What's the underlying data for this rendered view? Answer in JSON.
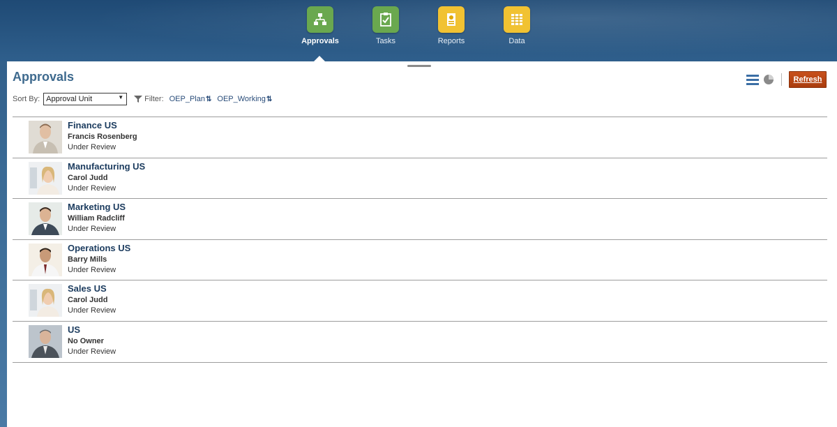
{
  "nav": {
    "items": [
      {
        "label": "Approvals",
        "icon": "approvals-hierarchy-icon",
        "color": "#6aa84f",
        "active": true
      },
      {
        "label": "Tasks",
        "icon": "tasks-clipboard-check-icon",
        "color": "#6aa84f",
        "active": false
      },
      {
        "label": "Reports",
        "icon": "reports-document-icon",
        "color": "#f1c232",
        "active": false
      },
      {
        "label": "Data",
        "icon": "data-grid-icon",
        "color": "#f1c232",
        "active": false
      }
    ]
  },
  "page": {
    "title": "Approvals",
    "refresh_label": "Refresh",
    "accent_color": "#b1451a"
  },
  "sort": {
    "label": "Sort By:",
    "selected": "Approval Unit"
  },
  "filter": {
    "label": "Filter:",
    "chips": [
      "OEP_Plan",
      "OEP_Working"
    ]
  },
  "approvals": [
    {
      "unit": "Finance US",
      "owner": "Francis Rosenberg",
      "status": "Under Review"
    },
    {
      "unit": "Manufacturing US",
      "owner": "Carol Judd",
      "status": "Under Review"
    },
    {
      "unit": "Marketing US",
      "owner": "William Radcliff",
      "status": "Under Review"
    },
    {
      "unit": "Operations US",
      "owner": "Barry Mills",
      "status": "Under Review"
    },
    {
      "unit": "Sales US",
      "owner": "Carol Judd",
      "status": "Under Review"
    },
    {
      "unit": "US",
      "owner": "No Owner",
      "status": "Under Review"
    }
  ]
}
